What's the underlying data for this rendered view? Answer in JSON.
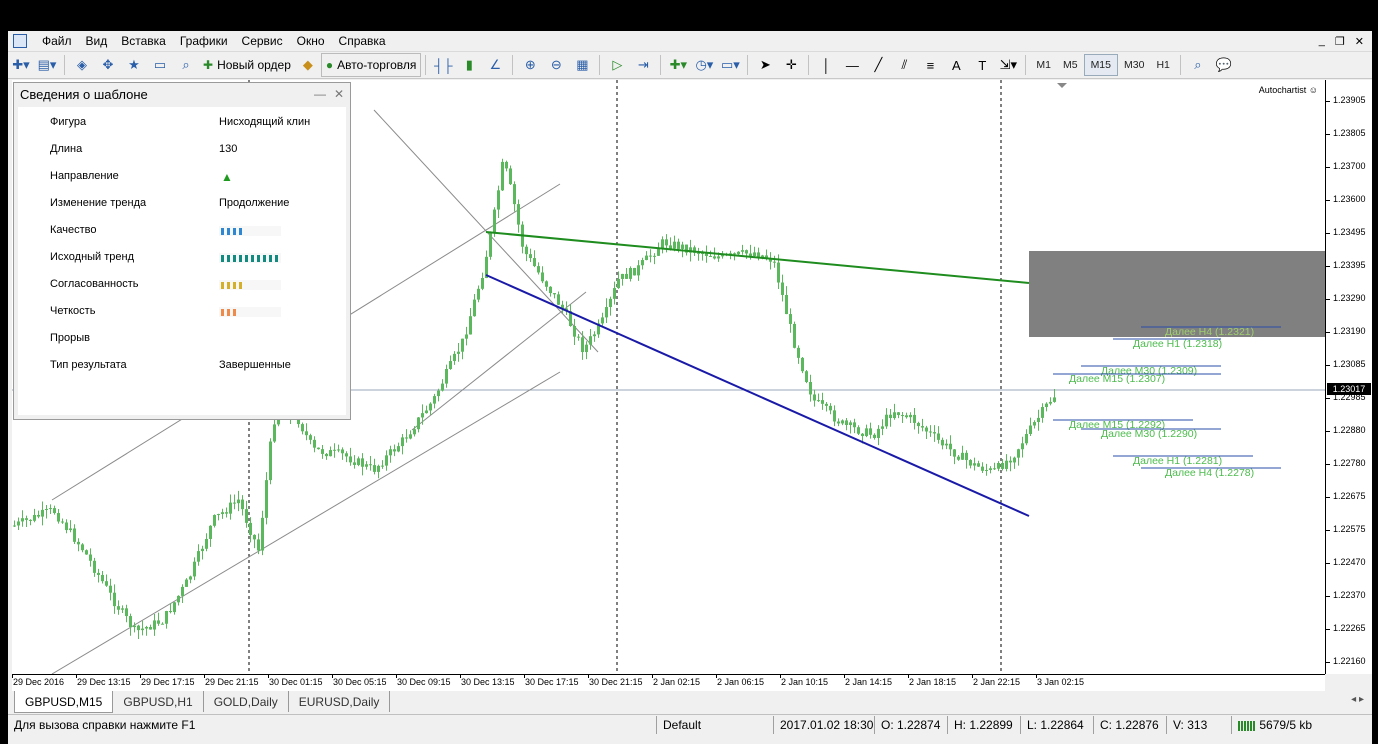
{
  "menu": [
    "Файл",
    "Вид",
    "Вставка",
    "Графики",
    "Сервис",
    "Окно",
    "Справка"
  ],
  "toolbar": {
    "new_order": "Новый ордер",
    "auto_trading": "Авто-торговля",
    "timeframes": [
      "M1",
      "M5",
      "M15",
      "M30",
      "H1"
    ],
    "active_timeframe": "M15"
  },
  "panel": {
    "title": "Сведения о шаблоне",
    "rows": [
      {
        "key": "Фигура",
        "value": "Нисходящий клин"
      },
      {
        "key": "Длина",
        "value": "130"
      },
      {
        "key": "Направление",
        "value": "▲"
      },
      {
        "key": "Изменение тренда",
        "value": "Продолжение"
      },
      {
        "key": "Качество",
        "value": ""
      },
      {
        "key": "Исходный тренд",
        "value": ""
      },
      {
        "key": "Согласованность",
        "value": ""
      },
      {
        "key": "Четкость",
        "value": ""
      },
      {
        "key": "Прорыв",
        "value": ""
      },
      {
        "key": "Тип результата",
        "value": "Завершенные"
      }
    ],
    "quality_bars": {
      "quality": 4,
      "initial_trend": 10,
      "consistency": 4,
      "clarity": 3
    },
    "colors": {
      "quality": "#2f86d1",
      "initial_trend": "#138a80",
      "consistency": "#d4b02a",
      "clarity": "#f08a4b",
      "direction_up": "#1f9a1f"
    }
  },
  "chart": {
    "autochartist_label": "Autochartist",
    "price_labels": [
      "1.23905",
      "1.23805",
      "1.23700",
      "1.23600",
      "1.23495",
      "1.23395",
      "1.23290",
      "1.23190",
      "1.23085",
      "1.22985",
      "1.22880",
      "1.22780",
      "1.22675",
      "1.22575",
      "1.22470",
      "1.22370",
      "1.22265",
      "1.22160"
    ],
    "current_price": "1.23017",
    "time_labels": [
      "29 Dec 2016",
      "29 Dec 13:15",
      "29 Dec 17:15",
      "29 Dec 21:15",
      "30 Dec 01:15",
      "30 Dec 05:15",
      "30 Dec 09:15",
      "30 Dec 13:15",
      "30 Dec 17:15",
      "30 Dec 21:15",
      "2 Jan 02:15",
      "2 Jan 06:15",
      "2 Jan 10:15",
      "2 Jan 14:15",
      "2 Jan 18:15",
      "2 Jan 22:15",
      "3 Jan 02:15"
    ],
    "levels": [
      {
        "label": "Далее H4 (1.2321)",
        "color": "#9fce6d"
      },
      {
        "label": "Далее H1 (1.2318)",
        "color": "#4cbc4c"
      },
      {
        "label": "Далее M30 (1.2309)",
        "color": "#4cbc4c"
      },
      {
        "label": "Далее M15 (1.2307)",
        "color": "#4cbc4c"
      },
      {
        "label": "Далее M15 (1.2292)",
        "color": "#4cbc4c"
      },
      {
        "label": "Далее M30 (1.2290)",
        "color": "#4cbc4c"
      },
      {
        "label": "Далее H1 (1.2281)",
        "color": "#4cbc4c"
      },
      {
        "label": "Далее H4 (1.2278)",
        "color": "#4cbc4c"
      }
    ],
    "colors": {
      "candle": "#5cb85c",
      "resistance": "#1e8c1e",
      "support": "#1a1aa8",
      "target_box": "#808080",
      "level_line": "#2a4ca8"
    }
  },
  "tabs": [
    "GBPUSD,M15",
    "GBPUSD,H1",
    "GOLD,Daily",
    "EURUSD,Daily"
  ],
  "active_tab": "GBPUSD,M15",
  "status": {
    "help": "Для вызова справки нажмите F1",
    "profile": "Default",
    "datetime": "2017.01.02 18:30",
    "open": "O: 1.22874",
    "high": "H: 1.22899",
    "low": "L: 1.22864",
    "close": "C: 1.22876",
    "volume": "V: 313",
    "traffic": "5679/5 kb"
  }
}
